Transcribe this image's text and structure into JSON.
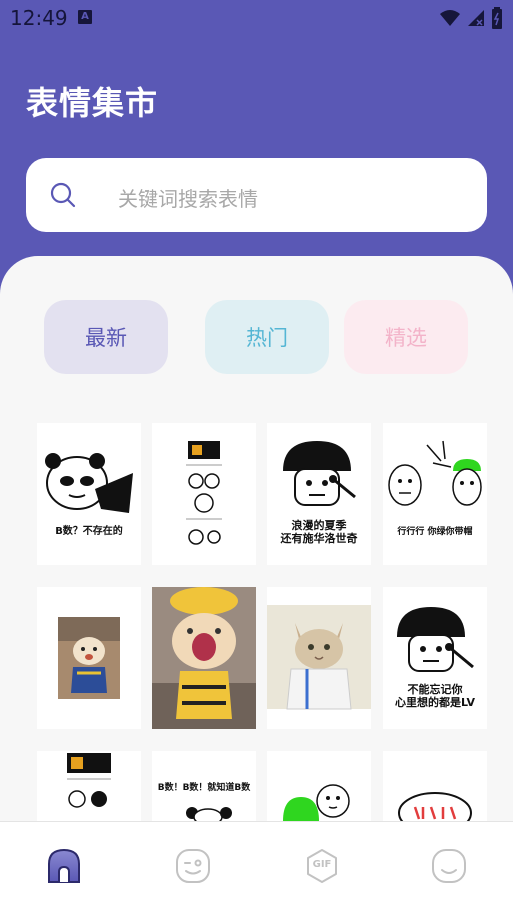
{
  "status": {
    "time": "12:49",
    "notification": "A"
  },
  "header": {
    "title": "表情集市"
  },
  "search": {
    "placeholder": "关键词搜索表情"
  },
  "tabs": [
    {
      "label": "最新"
    },
    {
      "label": "热门"
    },
    {
      "label": "精选"
    }
  ],
  "grid": [
    {
      "caption": "B数？不存在的",
      "icon": "panda-meme"
    },
    {
      "caption": "",
      "icon": "comic-strip-meme"
    },
    {
      "caption_lines": [
        "浪漫的夏季",
        "还有施华洛世奇"
      ],
      "icon": "mushroom-head-meme"
    },
    {
      "caption": "行行行 你绿你带帽",
      "icon": "green-hat-meme"
    },
    {
      "caption": "",
      "icon": "dog-photo"
    },
    {
      "caption": "",
      "icon": "cat-yellow-hat-photo"
    },
    {
      "caption": "",
      "icon": "cat-doctor-photo"
    },
    {
      "caption_lines": [
        "不能忘记你",
        "心里想的都是LV"
      ],
      "icon": "mushroom-head-meme"
    },
    {
      "caption": "",
      "icon": "comic-strip-meme"
    },
    {
      "caption": "B数！B数！就知道B数",
      "icon": "panda-meme"
    },
    {
      "caption": "",
      "icon": "green-hat-meme"
    },
    {
      "caption": "",
      "icon": "speech-bubble-meme"
    }
  ],
  "nav": [
    {
      "icon": "home-icon"
    },
    {
      "icon": "emoji-wink-icon"
    },
    {
      "icon": "gif-icon",
      "label": "GIF"
    },
    {
      "icon": "smile-icon"
    }
  ],
  "colors": {
    "primary": "#5a58b5",
    "hot": "#55b6d4",
    "pick": "#f3b3c9",
    "green_hat": "#2fd61f"
  }
}
